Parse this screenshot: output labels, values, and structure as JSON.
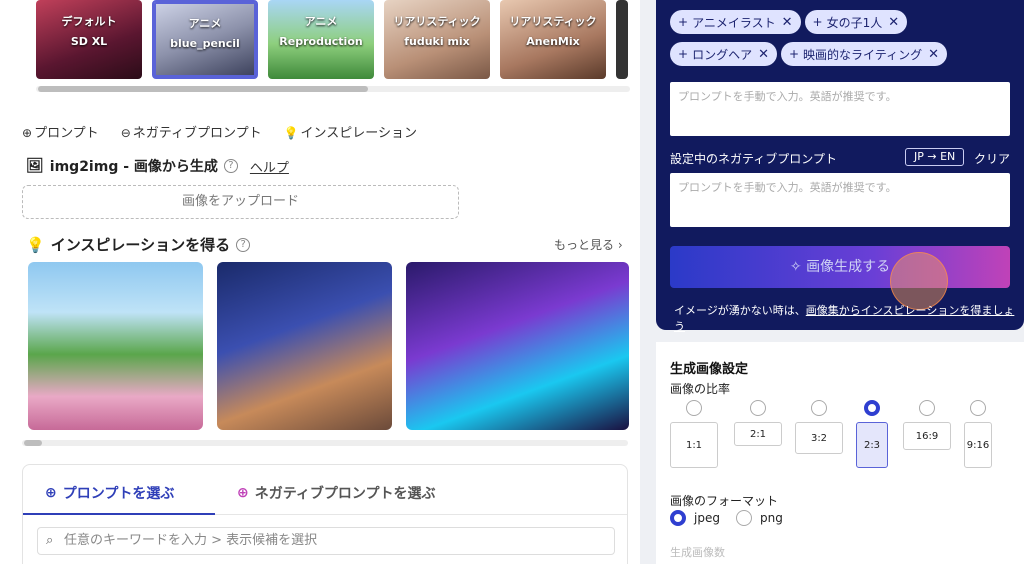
{
  "models": [
    {
      "line1": "デフォルト",
      "line2": "SD XL"
    },
    {
      "line1": "アニメ",
      "line2": "blue_pencil"
    },
    {
      "line1": "アニメ",
      "line2": "Reproduction"
    },
    {
      "line1": "リアリスティック",
      "line2": "fuduki mix"
    },
    {
      "line1": "リアリスティック",
      "line2": "AnenMix"
    }
  ],
  "prompt_links": [
    "プロンプト",
    "ネガティブプロンプト",
    "インスピレーション"
  ],
  "img2img": {
    "title": "img2img - 画像から生成",
    "help": "ヘルプ",
    "upload": "画像をアップロード"
  },
  "inspiration": {
    "title": "インスピレーションを得る",
    "more": "もっと見る ›"
  },
  "tabs": {
    "prompt": "プロンプトを選ぶ",
    "negative": "ネガティブプロンプトを選ぶ"
  },
  "keyword_placeholder": "任意のキーワードを入力 > 表示候補を選択",
  "chips": [
    "アニメイラスト",
    "女の子1人",
    "ロングヘア",
    "映画的なライティング"
  ],
  "prompt_placeholder": "プロンプトを手動で入力。英語が推奨です。",
  "negative": {
    "label": "設定中のネガティブプロンプト",
    "translate": "JP → EN",
    "clear": "クリア",
    "placeholder": "プロンプトを手動で入力。英語が推奨です。"
  },
  "generate_button": "✧ 画像生成する",
  "hint": {
    "text": "イメージが湧かない時は、",
    "link": "画像集からインスピレーションを得ましょう"
  },
  "settings": {
    "title": "生成画像設定",
    "ratio_label": "画像の比率",
    "ratios": [
      {
        "label": "1:1",
        "selected": false
      },
      {
        "label": "2:1",
        "selected": false
      },
      {
        "label": "3:2",
        "selected": false
      },
      {
        "label": "2:3",
        "selected": true
      },
      {
        "label": "16:9",
        "selected": false
      },
      {
        "label": "9:16",
        "selected": false
      }
    ],
    "format_label": "画像のフォーマット",
    "formats": [
      {
        "label": "jpeg",
        "selected": true
      },
      {
        "label": "png",
        "selected": false
      }
    ],
    "count_label": "生成画像数"
  },
  "colors": {
    "accent": "#2f3fd0",
    "panel": "#111a5e",
    "chip": "#dfe3ff"
  }
}
